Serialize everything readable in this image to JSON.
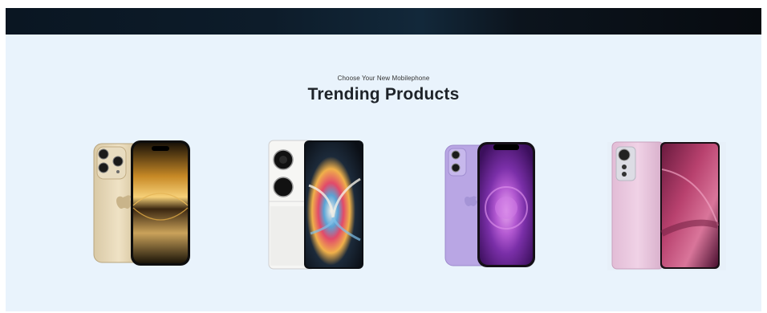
{
  "section": {
    "subtitle": "Choose Your New Mobilephone",
    "title": "Trending Products"
  },
  "products": [
    {
      "image": "gold-iphone-phone-image"
    },
    {
      "image": "white-flip-phone-image"
    },
    {
      "image": "purple-iphone-phone-image"
    },
    {
      "image": "pink-android-phone-image"
    }
  ],
  "colors": {
    "banner": "#0d1c2a",
    "background": "#e9f3fc",
    "title": "#1e2329"
  }
}
